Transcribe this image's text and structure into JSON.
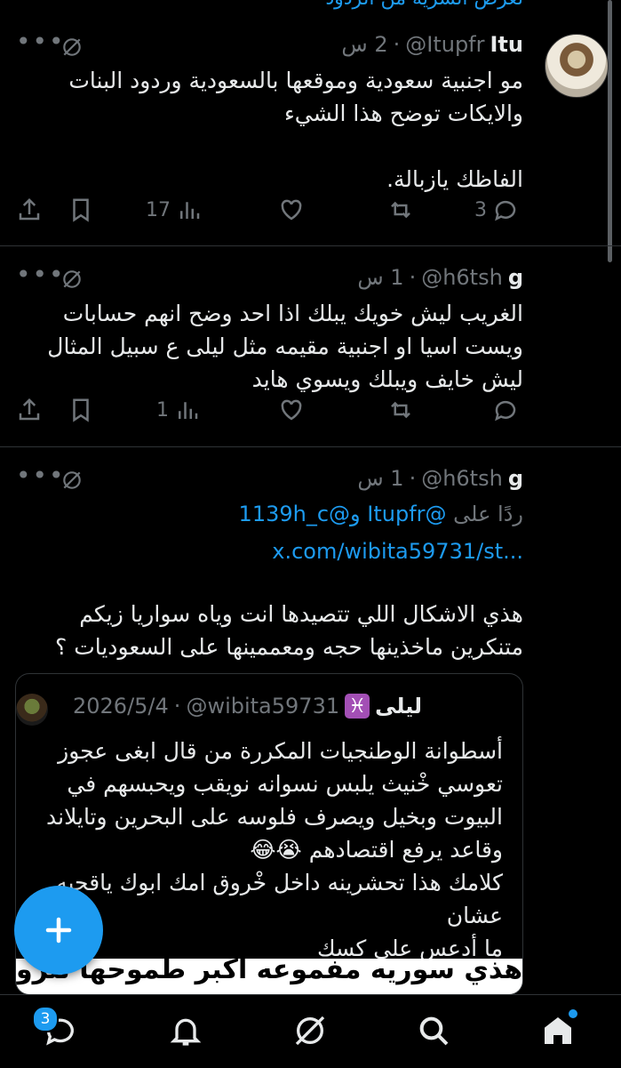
{
  "top_partial_text": "تعرض السرية من الردود",
  "tweets": [
    {
      "name": "Itu",
      "handle": "@Itupfr",
      "time": "2 س",
      "text": "مو اجنبية سعودية وموقعها بالسعودية وردود البنات\nوالايكات توضح هذا الشيء\n\nالفاظك يازبالة.",
      "replies": "3",
      "views": "17"
    },
    {
      "name": "g",
      "handle": "@h6tsh",
      "time": "1 س",
      "text": "الغريب ليش خويك يبلك اذا احد وضح انهم حسابات\nويست اسيا او اجنبية مقيمه مثل ليلى ع سبيل المثال\nليش خايف ويبلك ويسوي هايد",
      "replies": "",
      "views": "1"
    },
    {
      "name": "g",
      "handle": "@h6tsh",
      "time": "1 س",
      "reply_prefix": "ردًا على",
      "reply_user1": "@Itupfr",
      "reply_and": "و",
      "reply_user2": "@1139h_c",
      "link": "x.com/wibita59731/st...",
      "text": "هذي الاشكال اللي تتصيدها انت وياه سواريا زيكم\nمتنكرين ماخذينها حجه ومعممينها على السعوديات ؟"
    }
  ],
  "quote": {
    "name": "ليلى",
    "zodiac": "♓",
    "handle": "@wibita59731",
    "date": "2026/5/4",
    "text": "أسطوانة الوطنجيات المكررة من قال ابغى عجوز\nتعوسي خْنيث يلبس نسوانه نويقب ويحبسهم في\nالبيوت وبخيل ويصرف فلوسه على البحرين وتايلاند\nوقاعد يرفع اقتصادهم 😭😂\nكلامك هذا تحشرينه داخل خْروق امك ابوك ياقحبه\nعشان\nما أدعس على كسك",
    "banner": "هذي سوريه مفموعه اكبر طموحها تتزوج شايب"
  },
  "nav": {
    "messages_badge": "3"
  },
  "colors": {
    "accent": "#1d9bf0",
    "muted": "#71767b",
    "text": "#e7e9ea",
    "border": "#2f3336"
  }
}
